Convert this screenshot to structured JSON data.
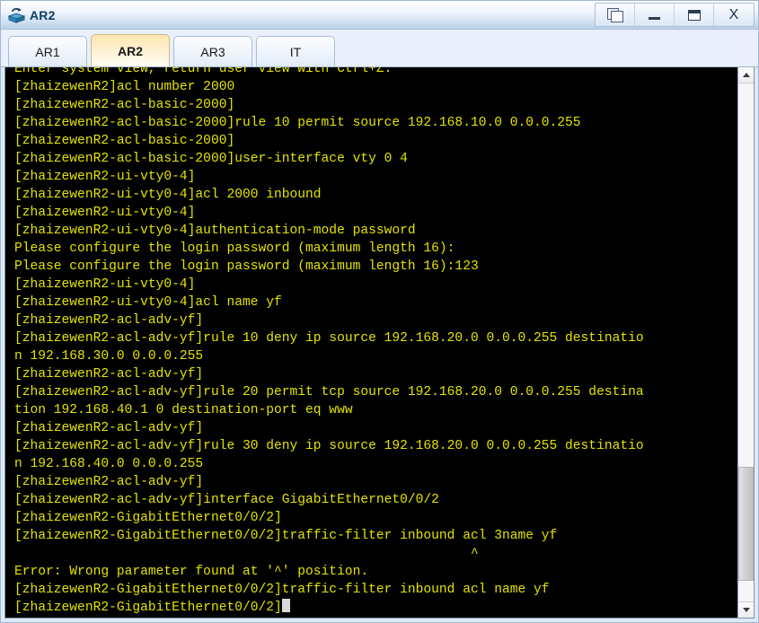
{
  "window": {
    "title": "AR2",
    "app_icon": "router-icon",
    "controls": [
      {
        "name": "restore-windows-button",
        "icon": "cascade-windows-icon",
        "label": ""
      },
      {
        "name": "minimize-button",
        "icon": "minimize-icon",
        "label": ""
      },
      {
        "name": "maximize-button",
        "icon": "maximize-icon",
        "label": ""
      },
      {
        "name": "close-button",
        "icon": "close-icon",
        "label": "X"
      }
    ]
  },
  "tabs": [
    {
      "label": "AR1",
      "active": false
    },
    {
      "label": "AR2",
      "active": true
    },
    {
      "label": "AR3",
      "active": false
    },
    {
      "label": "IT",
      "active": false
    }
  ],
  "terminal": {
    "foreground_color": "#e3e300",
    "background_color": "#000000",
    "cursor": "block",
    "lines": [
      "Enter system view, return user view with Ctrl+Z.",
      "[zhaizewenR2]acl number 2000",
      "[zhaizewenR2-acl-basic-2000]",
      "[zhaizewenR2-acl-basic-2000]rule 10 permit source 192.168.10.0 0.0.0.255",
      "[zhaizewenR2-acl-basic-2000]",
      "[zhaizewenR2-acl-basic-2000]user-interface vty 0 4",
      "[zhaizewenR2-ui-vty0-4]",
      "[zhaizewenR2-ui-vty0-4]acl 2000 inbound",
      "[zhaizewenR2-ui-vty0-4]",
      "[zhaizewenR2-ui-vty0-4]authentication-mode password",
      "Please configure the login password (maximum length 16):",
      "Please configure the login password (maximum length 16):123",
      "[zhaizewenR2-ui-vty0-4]",
      "[zhaizewenR2-ui-vty0-4]acl name yf",
      "[zhaizewenR2-acl-adv-yf]",
      "[zhaizewenR2-acl-adv-yf]rule 10 deny ip source 192.168.20.0 0.0.0.255 destinatio",
      "n 192.168.30.0 0.0.0.255",
      "[zhaizewenR2-acl-adv-yf]",
      "[zhaizewenR2-acl-adv-yf]rule 20 permit tcp source 192.168.20.0 0.0.0.255 destina",
      "tion 192.168.40.1 0 destination-port eq www",
      "[zhaizewenR2-acl-adv-yf]",
      "[zhaizewenR2-acl-adv-yf]rule 30 deny ip source 192.168.20.0 0.0.0.255 destinatio",
      "n 192.168.40.0 0.0.0.255",
      "[zhaizewenR2-acl-adv-yf]",
      "[zhaizewenR2-acl-adv-yf]interface GigabitEthernet0/0/2",
      "[zhaizewenR2-GigabitEthernet0/0/2]",
      "[zhaizewenR2-GigabitEthernet0/0/2]traffic-filter inbound acl 3name yf",
      "                                                          ^",
      "Error: Wrong parameter found at '^' position.",
      "[zhaizewenR2-GigabitEthernet0/0/2]traffic-filter inbound acl name yf"
    ],
    "prompt_line": "[zhaizewenR2-GigabitEthernet0/0/2]"
  },
  "scrollbar": {
    "up_arrow": "chevron-up-icon",
    "down_arrow": "chevron-down-icon",
    "thumb_top_percent": 74,
    "thumb_height_percent": 22
  }
}
